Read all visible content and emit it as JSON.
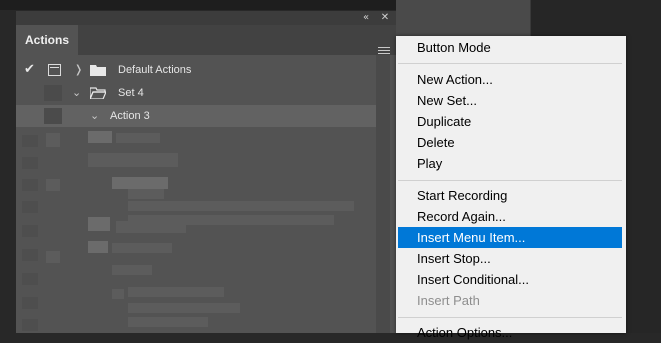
{
  "panel": {
    "title": "Actions",
    "rows": [
      {
        "label": "Default Actions",
        "checked": true,
        "expanded": false
      },
      {
        "label": "Set 4",
        "expanded": true
      },
      {
        "label": "Action 3",
        "expanded": true,
        "selected": true
      }
    ]
  },
  "menu": {
    "groups": [
      [
        "Button Mode"
      ],
      [
        "New Action...",
        "New Set...",
        "Duplicate",
        "Delete",
        "Play"
      ],
      [
        "Start Recording",
        "Record Again...",
        "Insert Menu Item...",
        "Insert Stop...",
        "Insert Conditional...",
        "Insert Path"
      ],
      [
        "Action Options..."
      ]
    ],
    "highlighted": "Insert Menu Item...",
    "disabled": [
      "Insert Path"
    ]
  },
  "colors": {
    "highlight": "#0078d7",
    "panel_bg": "#535353",
    "menu_bg": "#f0f0f0"
  }
}
